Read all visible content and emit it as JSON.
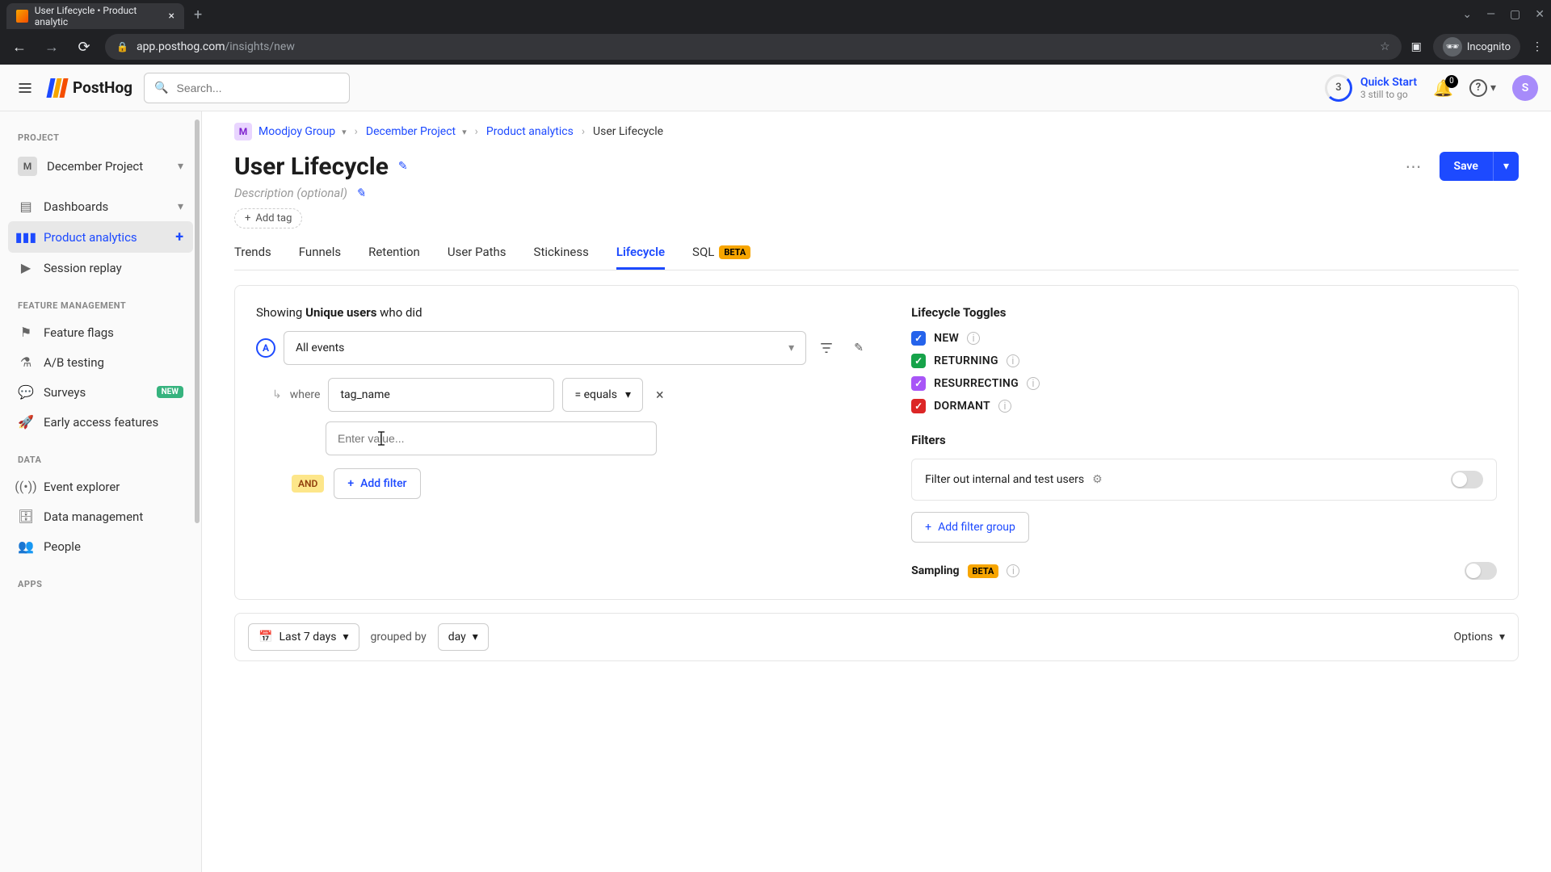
{
  "browser": {
    "tab_title": "User Lifecycle • Product analytic",
    "url_host": "app.posthog.com",
    "url_path": "/insights/new",
    "incognito_label": "Incognito"
  },
  "header": {
    "logo_text": "PostHog",
    "search_placeholder": "Search...",
    "quickstart_badge": "3",
    "quickstart_title": "Quick Start",
    "quickstart_sub": "3 still to go",
    "notif_count": "0",
    "user_initial": "S"
  },
  "sidebar": {
    "section_project": "PROJECT",
    "project_letter": "M",
    "project_name": "December Project",
    "items_main": [
      {
        "label": "Dashboards"
      },
      {
        "label": "Product analytics"
      },
      {
        "label": "Session replay"
      }
    ],
    "section_feature": "FEATURE MANAGEMENT",
    "items_feature": [
      {
        "label": "Feature flags"
      },
      {
        "label": "A/B testing"
      },
      {
        "label": "Surveys",
        "badge": "NEW"
      },
      {
        "label": "Early access features"
      }
    ],
    "section_data": "DATA",
    "items_data": [
      {
        "label": "Event explorer"
      },
      {
        "label": "Data management"
      },
      {
        "label": "People"
      }
    ],
    "section_apps": "APPS"
  },
  "breadcrumb": {
    "org_letter": "M",
    "org": "Moodjoy Group",
    "project": "December Project",
    "section": "Product analytics",
    "page": "User Lifecycle"
  },
  "page": {
    "title": "User Lifecycle",
    "description_placeholder": "Description (optional)",
    "add_tag": "Add tag",
    "save": "Save"
  },
  "tabs": [
    "Trends",
    "Funnels",
    "Retention",
    "User Paths",
    "Stickiness",
    "Lifecycle",
    "SQL"
  ],
  "tabs_beta_label": "BETA",
  "query": {
    "showing_prefix": "Showing ",
    "showing_bold": "Unique users",
    "showing_suffix": " who did",
    "series_letter": "A",
    "event": "All events",
    "where_label": "where",
    "property": "tag_name",
    "operator": "= equals",
    "value_placeholder": "Enter value...",
    "and_label": "AND",
    "add_filter": "Add filter"
  },
  "lifecycle": {
    "heading": "Lifecycle Toggles",
    "items": [
      {
        "label": "NEW",
        "color": "blue"
      },
      {
        "label": "RETURNING",
        "color": "green"
      },
      {
        "label": "RESURRECTING",
        "color": "purple"
      },
      {
        "label": "DORMANT",
        "color": "red"
      }
    ]
  },
  "filters": {
    "heading": "Filters",
    "internal_label": "Filter out internal and test users",
    "add_group": "Add filter group"
  },
  "sampling": {
    "label": "Sampling",
    "badge": "BETA"
  },
  "bottom": {
    "range": "Last 7 days",
    "grouped_label": "grouped by",
    "group_unit": "day",
    "options": "Options"
  }
}
